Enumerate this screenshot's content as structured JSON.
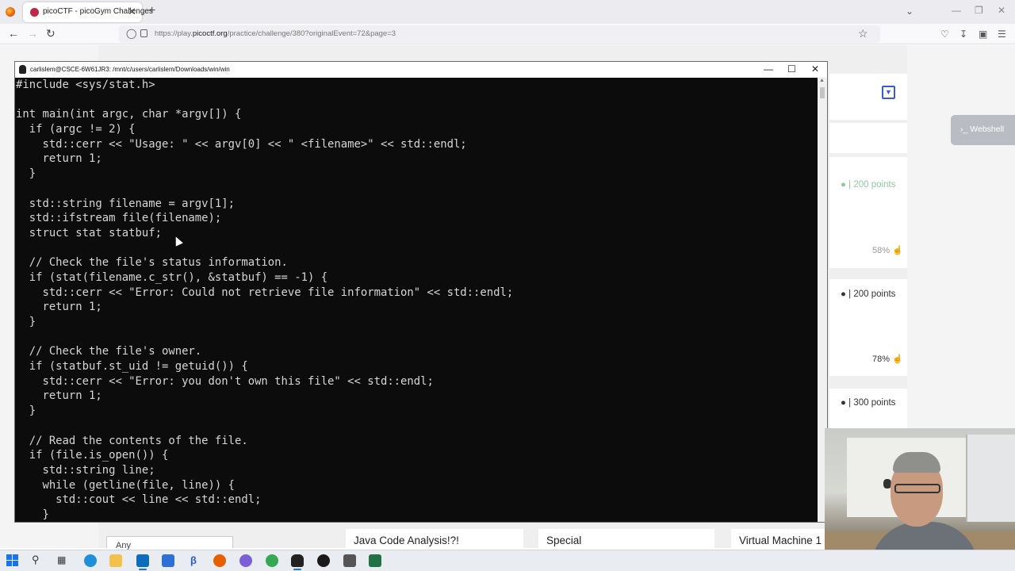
{
  "browser": {
    "tab_title": "picoCTF - picoGym Challenges",
    "tab_close": "✕",
    "new_tab": "+",
    "url_prefix": "https://play.",
    "url_domain": "picoctf.org",
    "url_path": "/practice/challenge/380?originalEvent=72&page=3"
  },
  "terminal": {
    "title": "carlislem@CSCE-6W61JR3: /mnt/c/users/carlislem/Downloads/win/win",
    "code_lines": [
      "#include <sys/stat.h>",
      "",
      "int main(int argc, char *argv[]) {",
      "  if (argc != 2) {",
      "    std::cerr << \"Usage: \" << argv[0] << \" <filename>\" << std::endl;",
      "    return 1;",
      "  }",
      "",
      "  std::string filename = argv[1];",
      "  std::ifstream file(filename);",
      "  struct stat statbuf;",
      "",
      "  // Check the file's status information.",
      "  if (stat(filename.c_str(), &statbuf) == -1) {",
      "    std::cerr << \"Error: Could not retrieve file information\" << std::endl;",
      "    return 1;",
      "  }",
      "",
      "  // Check the file's owner.",
      "  if (statbuf.st_uid != getuid()) {",
      "    std::cerr << \"Error: you don't own this file\" << std::endl;",
      "    return 1;",
      "  }",
      "",
      "  // Read the contents of the file.",
      "  if (file.is_open()) {",
      "    std::string line;",
      "    while (getline(file, line)) {",
      "      std::cout << line << std::endl;",
      "    }"
    ]
  },
  "site": {
    "webshell_label": "Webshell",
    "cards": [
      {
        "points": "| 200 points",
        "rating": "58%",
        "faded": true
      },
      {
        "points": "| 200 points",
        "rating": "78%",
        "faded": false
      },
      {
        "points": "| 300 points",
        "rating": "",
        "faded": false
      }
    ],
    "filter_value": "Any",
    "challenge_titles": [
      "Java Code Analysis!?!",
      "Special",
      "Virtual Machine 1"
    ]
  },
  "colors": {
    "terminal_bg": "#0c0c0c",
    "terminal_text": "#d6d6d6",
    "accent_blue": "#3a5bd9",
    "webshell_bg": "#b9bcc2"
  }
}
